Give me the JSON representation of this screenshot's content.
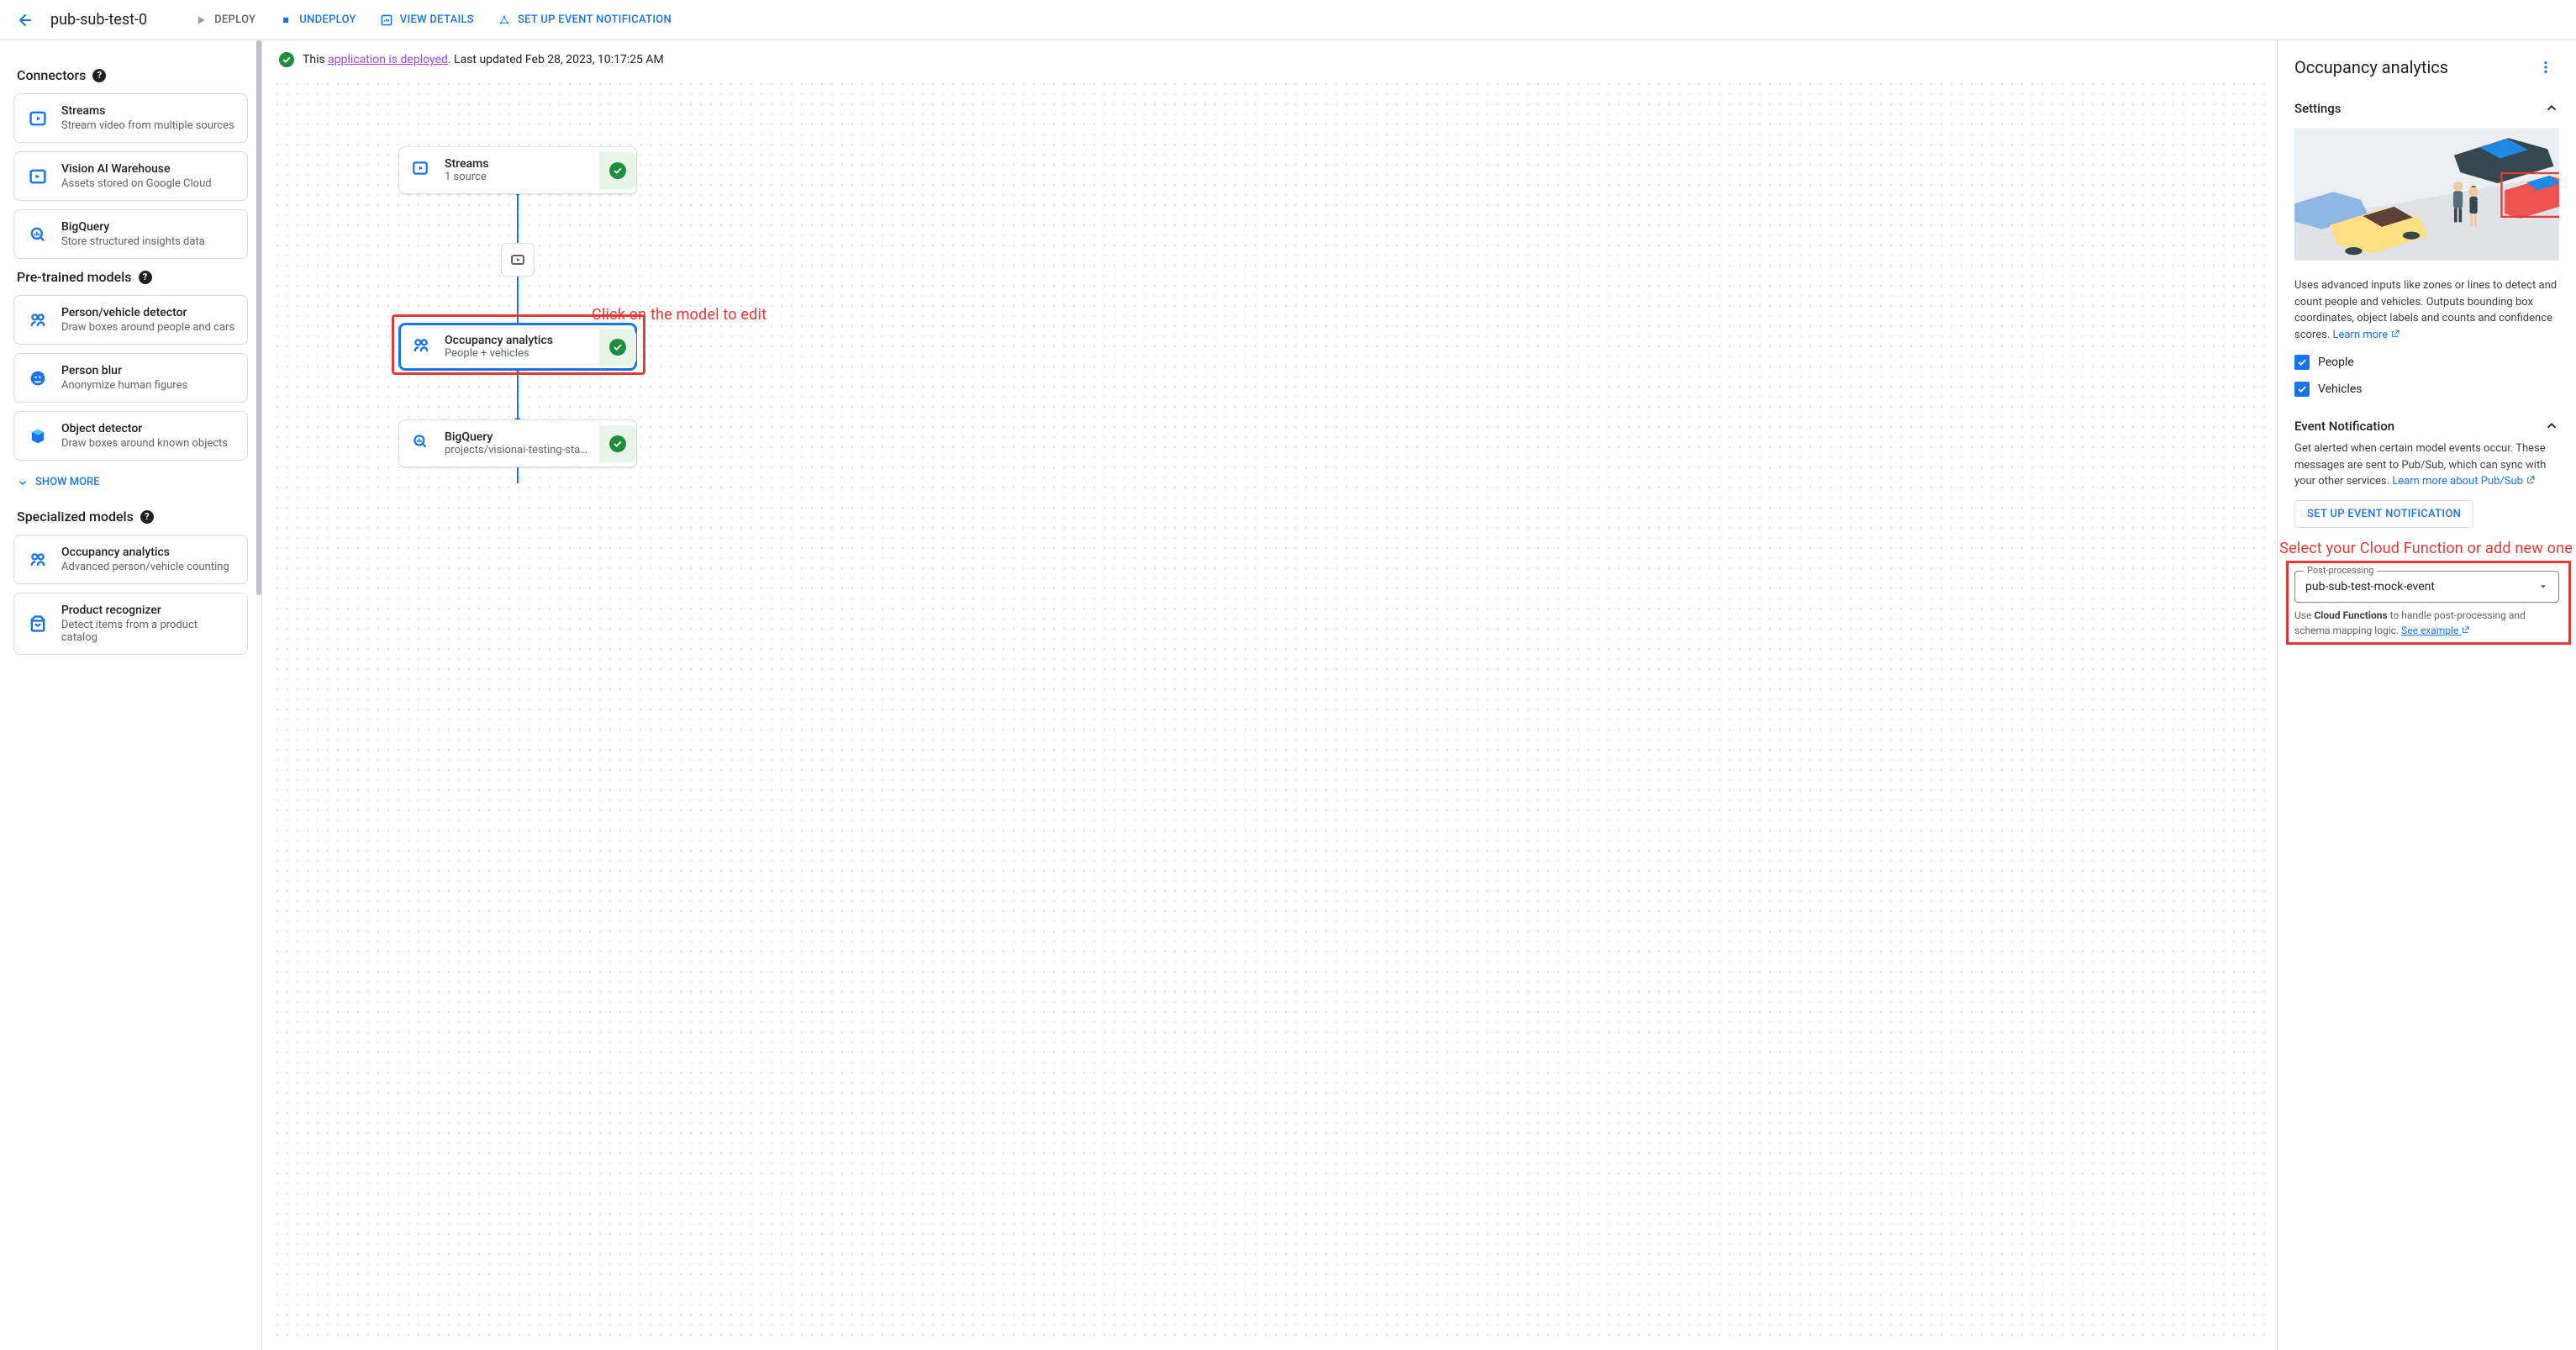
{
  "header": {
    "title": "pub-sub-test-0",
    "actions": {
      "deploy": "DEPLOY",
      "undeploy": "UNDEPLOY",
      "view_details": "VIEW DETAILS",
      "setup_event": "SET UP EVENT NOTIFICATION"
    }
  },
  "status": {
    "prefix": "This ",
    "link": "application is deployed",
    "suffix": ". Last updated Feb 28, 2023, 10:17:25 AM"
  },
  "sidebar": {
    "connectors_title": "Connectors",
    "connectors": [
      {
        "title": "Streams",
        "sub": "Stream video from multiple sources",
        "icon": "streams"
      },
      {
        "title": "Vision AI Warehouse",
        "sub": "Assets stored on Google Cloud",
        "icon": "warehouse"
      },
      {
        "title": "BigQuery",
        "sub": "Store structured insights data",
        "icon": "bigquery"
      }
    ],
    "pretrained_title": "Pre-trained models",
    "pretrained": [
      {
        "title": "Person/vehicle detector",
        "sub": "Draw boxes around people and cars",
        "icon": "pv"
      },
      {
        "title": "Person blur",
        "sub": "Anonymize human figures",
        "icon": "blur"
      },
      {
        "title": "Object detector",
        "sub": "Draw boxes around known objects",
        "icon": "object"
      }
    ],
    "show_more": "SHOW MORE",
    "specialized_title": "Specialized models",
    "specialized": [
      {
        "title": "Occupancy analytics",
        "sub": "Advanced person/vehicle counting",
        "icon": "pv"
      },
      {
        "title": "Product recognizer",
        "sub": "Detect items from a product catalog",
        "icon": "product"
      }
    ]
  },
  "canvas": {
    "nodes": {
      "streams": {
        "title": "Streams",
        "sub": "1 source"
      },
      "occupancy": {
        "title": "Occupancy analytics",
        "sub": "People + vehicles"
      },
      "bigquery": {
        "title": "BigQuery",
        "sub": "projects/visionai-testing-stabl…"
      }
    },
    "anno1": "Click on the model to edit"
  },
  "details": {
    "title": "Occupancy analytics",
    "settings_title": "Settings",
    "desc": "Uses advanced inputs like zones or lines to detect and count people and vehicles. Outputs bounding box coordinates, object labels and counts and confidence scores. ",
    "learn_more": "Learn more",
    "cb_people": "People",
    "cb_vehicles": "Vehicles",
    "event_title": "Event Notification",
    "event_desc": "Get alerted when certain model events occur. These messages are sent to Pub/Sub, which can sync with your other services. ",
    "event_link": "Learn more about Pub/Sub",
    "setup_btn": "SET UP EVENT NOTIFICATION",
    "anno2": "Select your Cloud Function or add new one",
    "post_label": "Post-processing",
    "post_value": "pub-sub-test-mock-event",
    "helper_pre": "Use ",
    "helper_bold": "Cloud Functions",
    "helper_post": " to handle post-processing and schema mapping logic. ",
    "helper_link": "See example"
  }
}
